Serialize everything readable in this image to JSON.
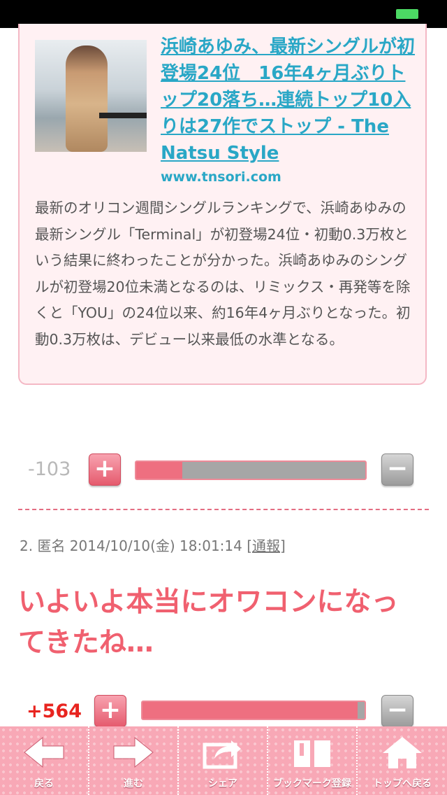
{
  "card": {
    "title": "浜崎あゆみ、最新シングルが初登場24位　16年4ヶ月ぶりトップ20落ち…連続トップ10入りは27作でストップ - The Natsu Style",
    "domain": "www.tnsori.com",
    "body": "最新のオリコン週間シングルランキングで、浜崎あゆみの最新シングル「Terminal」が初登場24位・初動0.3万枚という結果に終わったことが分かった。浜崎あゆみのシングルが初登場20位未満となるのは、リミックス・再発等を除くと「YOU」の24位以来、約16年4ヶ月ぶりとなった。初動0.3万枚は、デビュー以来最低の水準となる。"
  },
  "vote1": {
    "score": "-103",
    "plus": "+",
    "minus": "−",
    "ratio": 0.2,
    "score_color": "#b8b8b8"
  },
  "comment2": {
    "meta": "2. 匿名 2014/10/10(金) 18:01:14 ",
    "report": "[通報]",
    "body": "いよいよ本当にオワコンになってきたね…"
  },
  "vote2": {
    "score": "+564",
    "plus": "+",
    "minus": "−",
    "ratio": 0.97,
    "score_color": "#e8241f"
  },
  "toolbar": {
    "items": [
      {
        "label": "戻る",
        "icon": "arrow-left-icon"
      },
      {
        "label": "進む",
        "icon": "arrow-right-icon"
      },
      {
        "label": "シェア",
        "icon": "share-icon"
      },
      {
        "label": "ブックマーク登録",
        "icon": "book-icon"
      },
      {
        "label": "トップへ戻る",
        "icon": "home-icon"
      }
    ]
  },
  "colors": {
    "accent": "#f0606f",
    "link": "#29a7c6",
    "toolbar": "#f8a8b6"
  }
}
